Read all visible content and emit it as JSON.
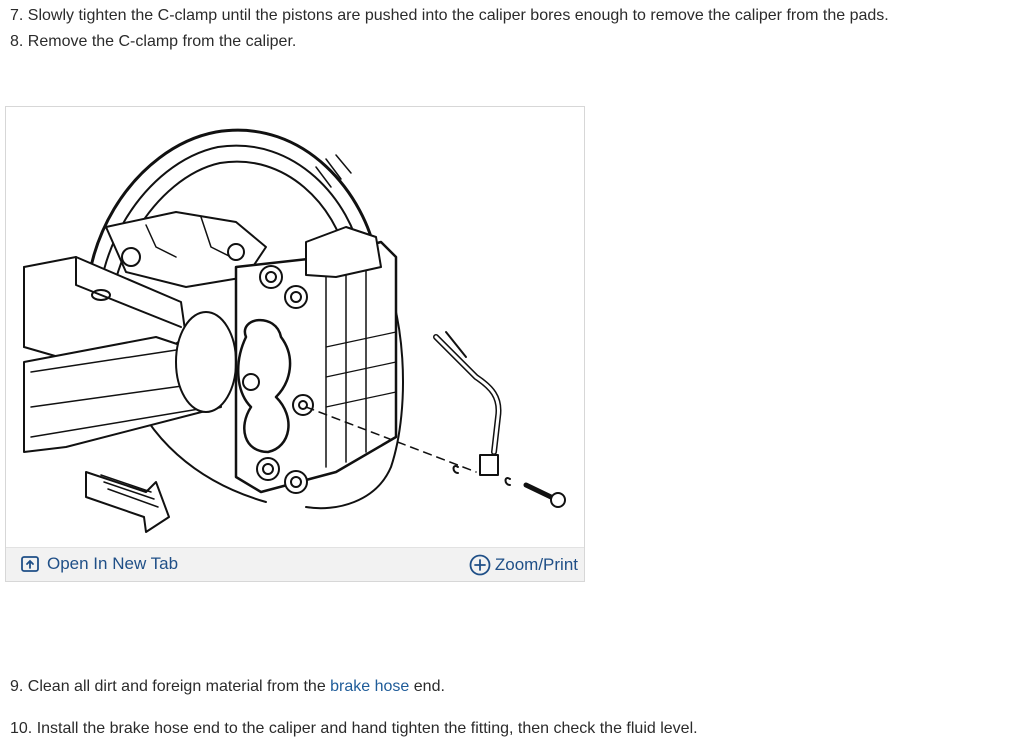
{
  "steps": {
    "step7": "7. Slowly tighten the C-clamp until the pistons are pushed into the caliper bores enough to remove the caliper from the pads.",
    "step8": "8. Remove the C-clamp from the caliper.",
    "step9_before": "9. Clean all dirt and foreign material from the ",
    "step9_link": "brake hose",
    "step9_after": " end.",
    "step10_partial": "10. Install the brake hose end to the caliper and hand tighten the fitting, then check the fluid level."
  },
  "figure": {
    "open_tab_label": "Open In New Tab",
    "open_tab_icon": "open-new-tab-icon",
    "zoom_label": "Zoom/Print",
    "zoom_icon": "plus-circle-icon",
    "accent_color": "#1f4f87"
  }
}
